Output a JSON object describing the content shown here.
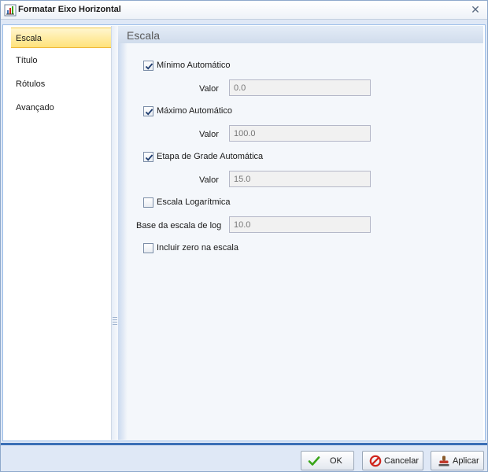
{
  "window": {
    "title": "Formatar Eixo Horizontal",
    "close_icon": "close-icon",
    "title_icon": "chart-axis-icon"
  },
  "nav": {
    "items": [
      {
        "label": "Escala",
        "selected": true
      },
      {
        "label": "Título",
        "selected": false
      },
      {
        "label": "Rótulos",
        "selected": false
      },
      {
        "label": "Avançado",
        "selected": false
      }
    ]
  },
  "panel": {
    "title": "Escala",
    "min_auto": {
      "label": "Mínimo Automático",
      "checked": true
    },
    "min_value": {
      "label": "Valor",
      "value": "0.0"
    },
    "max_auto": {
      "label": "Máximo Automático",
      "checked": true
    },
    "max_value": {
      "label": "Valor",
      "value": "100.0"
    },
    "grid_auto": {
      "label": "Etapa de Grade Automática",
      "checked": true
    },
    "grid_value": {
      "label": "Valor",
      "value": "15.0"
    },
    "log_scale": {
      "label": "Escala Logarítmica",
      "checked": false
    },
    "log_base": {
      "label": "Base da escala de log",
      "value": "10.0"
    },
    "include_zero": {
      "label": "Incluir zero na escala",
      "checked": false
    }
  },
  "footer": {
    "ok_label": "OK",
    "cancel_label": "Cancelar",
    "apply_label": "Aplicar"
  },
  "colors": {
    "selected_nav": "#ffe27a",
    "footer_accent": "#3b6fb6",
    "ok_icon": "#3aa51a",
    "cancel_icon": "#d0241c"
  }
}
